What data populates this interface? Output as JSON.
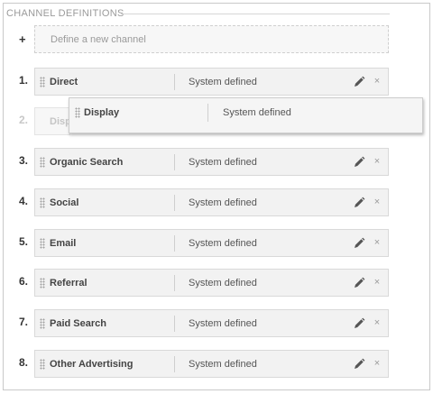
{
  "section": {
    "title": "CHANNEL DEFINITIONS"
  },
  "add": {
    "plus": "+",
    "label": "Define a new channel"
  },
  "icons": {
    "edit": "pencil-icon",
    "remove": "close-icon",
    "drag": "drag-handle-icon"
  },
  "rows": [
    {
      "num": "1.",
      "name": "Direct",
      "type": "System defined"
    },
    {
      "num": "2.",
      "name": "Disp",
      "type": ""
    },
    {
      "num": "3.",
      "name": "Organic Search",
      "type": "System defined"
    },
    {
      "num": "4.",
      "name": "Social",
      "type": "System defined"
    },
    {
      "num": "5.",
      "name": "Email",
      "type": "System defined"
    },
    {
      "num": "6.",
      "name": "Referral",
      "type": "System defined"
    },
    {
      "num": "7.",
      "name": "Paid Search",
      "type": "System defined"
    },
    {
      "num": "8.",
      "name": "Other Advertising",
      "type": "System defined"
    }
  ],
  "dragging": {
    "name": "Display",
    "type": "System defined"
  },
  "glyphs": {
    "close": "×"
  }
}
